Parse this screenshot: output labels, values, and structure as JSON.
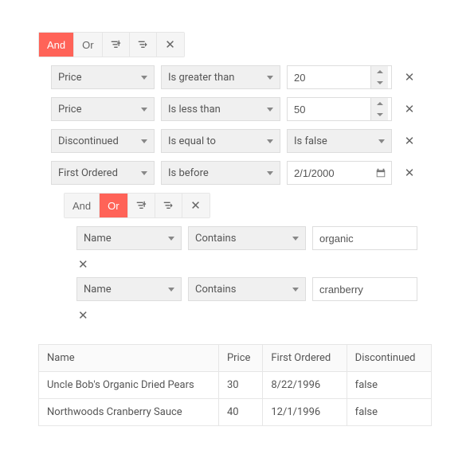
{
  "logic": {
    "and": "And",
    "or": "Or"
  },
  "root": {
    "active": "and",
    "rules": [
      {
        "field": "Price",
        "op": "Is greater than",
        "value": "20",
        "type": "number"
      },
      {
        "field": "Price",
        "op": "Is less than",
        "value": "50",
        "type": "number"
      },
      {
        "field": "Discontinued",
        "op": "Is equal to",
        "value": "Is false",
        "type": "select"
      },
      {
        "field": "First Ordered",
        "op": "Is before",
        "value": "2/1/2000",
        "type": "date"
      }
    ],
    "group": {
      "active": "or",
      "rules": [
        {
          "field": "Name",
          "op": "Contains",
          "value": "organic",
          "type": "text"
        },
        {
          "field": "Name",
          "op": "Contains",
          "value": "cranberry",
          "type": "text"
        }
      ]
    }
  },
  "table": {
    "headers": [
      "Name",
      "Price",
      "First Ordered",
      "Discontinued"
    ],
    "rows": [
      [
        "Uncle Bob's Organic Dried Pears",
        "30",
        "8/22/1996",
        "false"
      ],
      [
        "Northwoods Cranberry Sauce",
        "40",
        "12/1/1996",
        "false"
      ]
    ]
  }
}
